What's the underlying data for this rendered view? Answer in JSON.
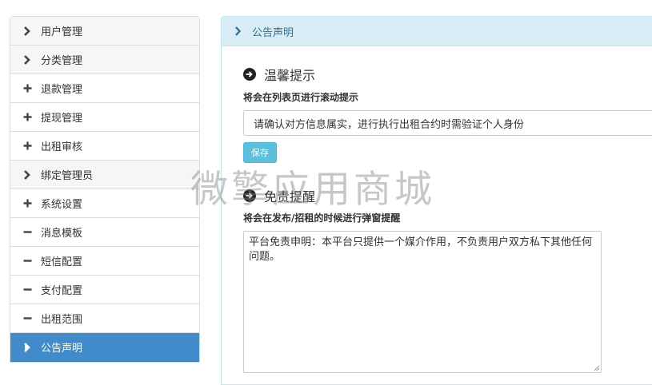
{
  "sidebar": {
    "items": [
      {
        "label": "用户管理",
        "icon": "chevron-right-icon"
      },
      {
        "label": "分类管理",
        "icon": "chevron-right-icon"
      },
      {
        "label": "退款管理",
        "icon": "plus-icon"
      },
      {
        "label": "提现管理",
        "icon": "plus-icon"
      },
      {
        "label": "出租审核",
        "icon": "plus-icon"
      },
      {
        "label": "绑定管理员",
        "icon": "chevron-right-icon"
      },
      {
        "label": "系统设置",
        "icon": "plus-icon"
      },
      {
        "label": "消息模板",
        "icon": "minus-icon"
      },
      {
        "label": "短信配置",
        "icon": "minus-icon"
      },
      {
        "label": "支付配置",
        "icon": "minus-icon"
      },
      {
        "label": "出租范围",
        "icon": "minus-icon"
      },
      {
        "label": "公告声明",
        "icon": "chevron-right-icon",
        "active": true
      }
    ]
  },
  "panel": {
    "title": "公告声明"
  },
  "notice": {
    "section_title": "温馨提示",
    "label": "将会在列表页进行滚动提示",
    "value": "请确认对方信息属实，进行执行出租合约时需验证个人身份",
    "save_label": "保存"
  },
  "disclaimer": {
    "section_title": "免责提醒",
    "label": "将会在发布/招租的时候进行弹窗提醒",
    "value": "平台免责申明：本平台只提供一个媒介作用，不负责用户双方私下其他任何问题。"
  },
  "watermark": "微擎应用商城",
  "colors": {
    "active": "#428bca",
    "panel_heading_bg": "#d9edf7",
    "save_button": "#5bc0de"
  }
}
